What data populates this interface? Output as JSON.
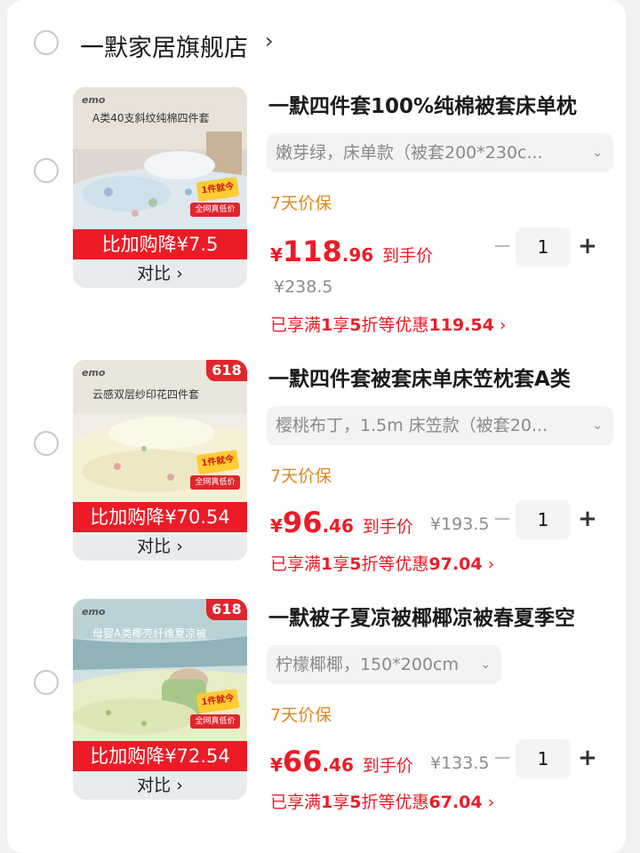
{
  "store": {
    "name": "一默家居旗舰店",
    "chevron": "›"
  },
  "colors": {
    "accent": "#ec1b26",
    "guarantee": "#d98a1e",
    "muted": "#8c8c8c"
  },
  "items": [
    {
      "title": "一默四件套100%纯棉被套床单枕",
      "spec": "嫩芽绿，床单款（被套200*230c...",
      "guarantee": "7天价保",
      "price": {
        "currency": "¥",
        "int": "118",
        "dec": ".96",
        "label": "到手价"
      },
      "original_price": "¥238.5",
      "discount": {
        "prefix": "已享满",
        "n1": "1",
        "mid1": "享",
        "n2": "5",
        "mid2": "折等优惠",
        "amount": "119.54",
        "chev": "›"
      },
      "quantity": "1",
      "image": {
        "brand": "emo",
        "caption": "A类40支斜纹纯棉四件套",
        "badge": "",
        "tag_today": "1件就今天!",
        "tag_low": "全网真低价"
      },
      "promo": "比加购降¥7.5",
      "compare": "对比 ›"
    },
    {
      "title": "一默四件套被套床单床笠枕套A类",
      "spec": "樱桃布丁，1.5m 床笠款（被套20...",
      "guarantee": "7天价保",
      "price": {
        "currency": "¥",
        "int": "96",
        "dec": ".46",
        "label": "到手价"
      },
      "original_price": "¥193.5",
      "discount": {
        "prefix": "已享满",
        "n1": "1",
        "mid1": "享",
        "n2": "5",
        "mid2": "折等优惠",
        "amount": "97.04",
        "chev": "›"
      },
      "quantity": "1",
      "image": {
        "brand": "emo",
        "caption": "云感双层纱印花四件套",
        "badge": "618",
        "tag_today": "1件就今天!",
        "tag_low": "全网真低价"
      },
      "promo": "比加购降¥70.54",
      "compare": "对比 ›"
    },
    {
      "title": "一默被子夏凉被椰椰凉被春夏季空",
      "spec": "柠檬椰椰，150*200cm",
      "guarantee": "7天价保",
      "price": {
        "currency": "¥",
        "int": "66",
        "dec": ".46",
        "label": "到手价"
      },
      "original_price": "¥133.5",
      "discount": {
        "prefix": "已享满",
        "n1": "1",
        "mid1": "享",
        "n2": "5",
        "mid2": "折等优惠",
        "amount": "67.04",
        "chev": "›"
      },
      "quantity": "1",
      "image": {
        "brand": "emo",
        "caption": "母婴A类椰壳纤维夏凉被",
        "badge": "618",
        "tag_today": "1件就今天!",
        "tag_low": "全网真低价"
      },
      "promo": "比加购降¥72.54",
      "compare": "对比 ›"
    }
  ],
  "stepper": {
    "minus": "−",
    "plus": "+"
  },
  "dropdown_icon": "⌄"
}
